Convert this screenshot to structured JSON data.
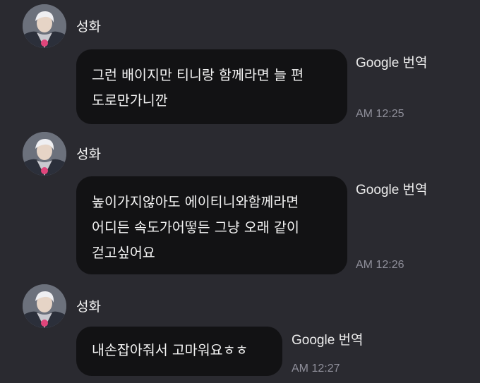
{
  "messages": [
    {
      "sender": "성화",
      "lines": [
        "그런 배이지만 티니랑 함께라면 늘 편",
        "도로만가니깐"
      ],
      "translate_label": "Google 번역",
      "time": "AM 12:25"
    },
    {
      "sender": "성화",
      "lines": [
        "높이가지않아도 에이티니와함께라면",
        "어디든 속도가어떻든 그냥 오래 같이",
        "걷고싶어요"
      ],
      "translate_label": "Google 번역",
      "time": "AM 12:26"
    },
    {
      "sender": "성화",
      "lines": [
        "내손잡아줘서 고마워요ㅎㅎ"
      ],
      "translate_label": "Google 번역",
      "time": "AM 12:27"
    }
  ]
}
